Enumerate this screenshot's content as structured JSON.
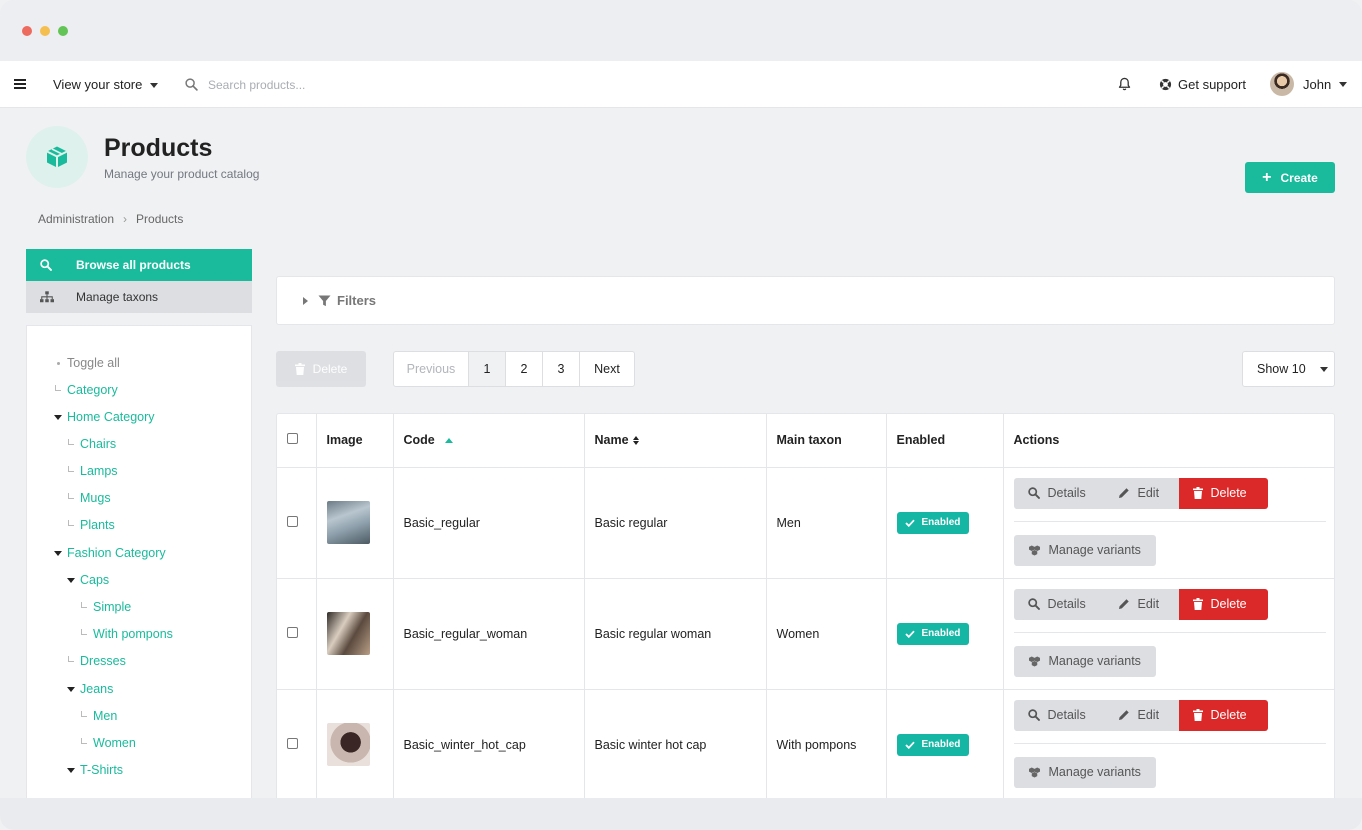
{
  "topbar": {
    "store_link": "View your store",
    "search_placeholder": "Search products...",
    "support": "Get support",
    "user_name": "John"
  },
  "header": {
    "title": "Products",
    "subtitle": "Manage your product catalog",
    "create_label": "Create"
  },
  "breadcrumb": [
    "Administration",
    "Products"
  ],
  "side_menu": [
    {
      "label": "Browse all products",
      "icon": "search-icon",
      "active": true
    },
    {
      "label": "Manage taxons",
      "icon": "sitemap-icon",
      "active": false
    }
  ],
  "tree": {
    "toggle_all": "Toggle all",
    "nodes": [
      {
        "label": "Category"
      },
      {
        "label": "Home Category"
      },
      {
        "label": "Chairs"
      },
      {
        "label": "Lamps"
      },
      {
        "label": "Mugs"
      },
      {
        "label": "Plants"
      },
      {
        "label": "Fashion Category"
      },
      {
        "label": "Caps"
      },
      {
        "label": "Simple"
      },
      {
        "label": "With pompons"
      },
      {
        "label": "Dresses"
      },
      {
        "label": "Jeans"
      },
      {
        "label": "Men"
      },
      {
        "label": "Women"
      },
      {
        "label": "T-Shirts"
      }
    ]
  },
  "filters_label": "Filters",
  "bulk_delete_label": "Delete",
  "pagination": {
    "previous": "Previous",
    "pages": [
      "1",
      "2",
      "3"
    ],
    "next": "Next",
    "current": "1"
  },
  "show_label": "Show 10",
  "table": {
    "columns": [
      "Image",
      "Code",
      "Name",
      "Main taxon",
      "Enabled",
      "Actions"
    ],
    "rows": [
      {
        "code": "Basic_regular",
        "name": "Basic regular",
        "taxon": "Men",
        "enabled": "Enabled"
      },
      {
        "code": "Basic_regular_woman",
        "name": "Basic regular woman",
        "taxon": "Women",
        "enabled": "Enabled"
      },
      {
        "code": "Basic_winter_hot_cap",
        "name": "Basic winter hot cap",
        "taxon": "With pompons",
        "enabled": "Enabled"
      }
    ],
    "actions": {
      "details": "Details",
      "edit": "Edit",
      "delete": "Delete",
      "variants": "Manage variants"
    }
  },
  "colors": {
    "accent": "#1abb9c",
    "danger": "#db2828",
    "enabled_badge": "#16b6a5"
  }
}
